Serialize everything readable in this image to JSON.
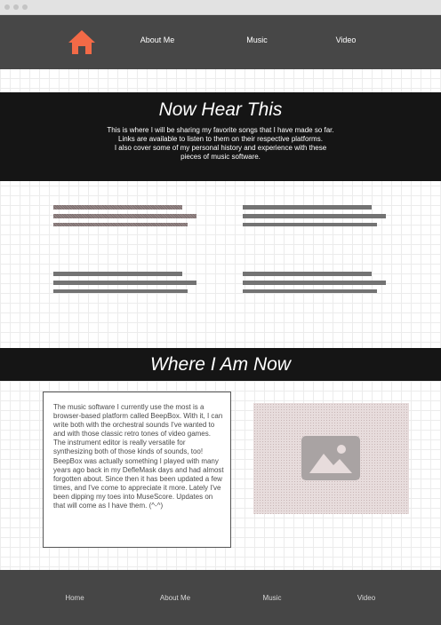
{
  "nav": {
    "home_icon": "home-icon",
    "about": "About Me",
    "music": "Music",
    "video": "Video"
  },
  "hero": {
    "title": "Now Hear This",
    "description_1": "This is where I will be sharing my favorite songs that I have made so far. Links are available to listen to them on their respective platforms.",
    "description_2": "I also cover some of my personal history and experience with these pieces of music software."
  },
  "section2": {
    "title": "Where I Am Now",
    "body": "The music software I currently use the most is a browser-based platform called BeepBox. With it, I can write both with the orchestral sounds I've wanted to and with those classic retro tones of video games. The instrument editor is really versatile for synthesizing both of those kinds of sounds, too! BeepBox was actually something I played with many years ago back in my DefleMask days and had almost forgotten about. Since then it has been updated a few times, and I've come to appreciate it more.  Lately I've been dipping my toes into MuseScore. Updates on that will come as I have them. (^-^)",
    "image_icon": "image-placeholder-icon"
  },
  "footer": {
    "home": "Home",
    "about": "About Me",
    "music": "Music",
    "video": "Video"
  },
  "colors": {
    "accent": "#f26a47",
    "nav_bg": "#474747",
    "band_bg": "#151515"
  }
}
